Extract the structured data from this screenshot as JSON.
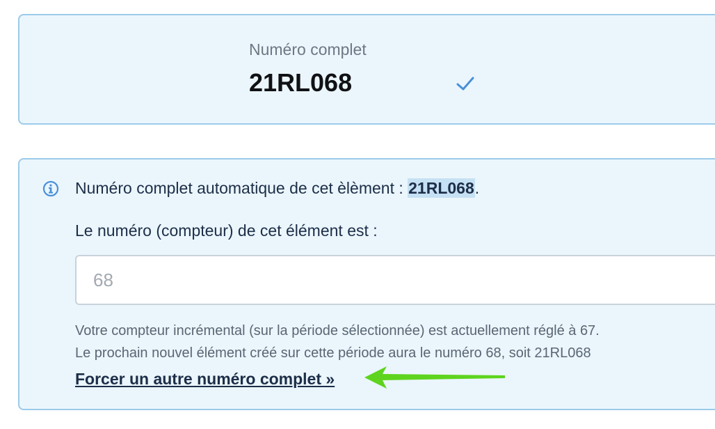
{
  "summary": {
    "label": "Numéro complet",
    "value": "21RL068"
  },
  "info": {
    "auto_prefix": "Numéro complet automatique de cet èlèment : ",
    "auto_code": "21RL068",
    "auto_suffix": ".",
    "counter_label": "Le numéro (compteur) de cet élément est :",
    "counter_placeholder": "68",
    "help_line1": "Votre compteur incrémental (sur la période sélectionnée) est actuellement réglé à 67.",
    "help_line2": "Le prochain nouvel élément créé sur cette période aura le numéro 68, soit 21RL068",
    "force_link": "Forcer un autre numéro complet »"
  },
  "colors": {
    "card_bg": "#eaf5fc",
    "card_border": "#9ccbea",
    "check": "#4a90d9",
    "annotation_arrow": "#5ed41e"
  },
  "icons": [
    "check-icon",
    "info-icon"
  ]
}
